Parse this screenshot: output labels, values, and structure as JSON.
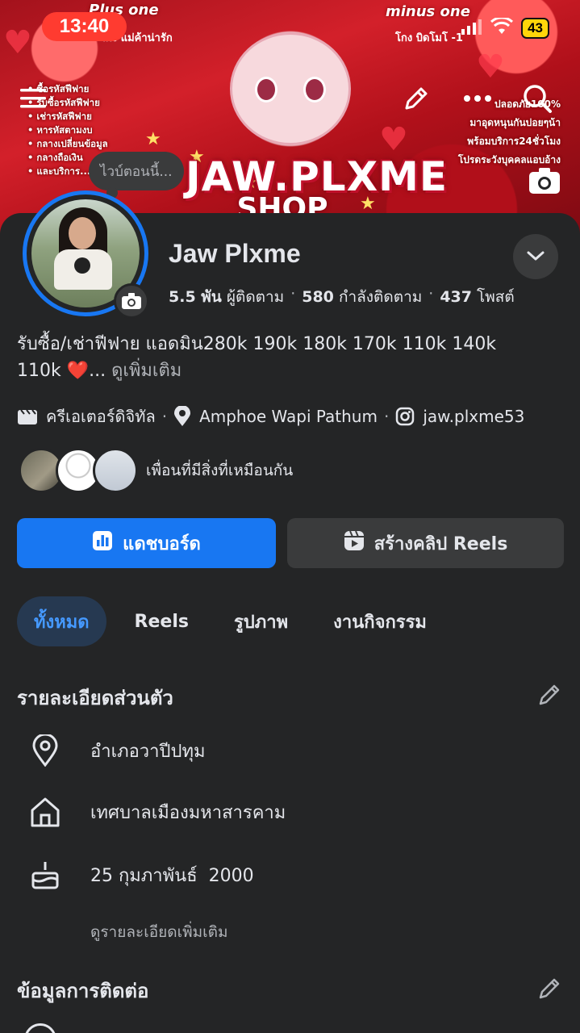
{
  "status_bar": {
    "time": "13:40",
    "battery": "43"
  },
  "cover": {
    "chip_left": "Plus one",
    "chip_left_sub": "โกง แม่ค้าน่ารัก",
    "chip_right": "minus one",
    "chip_right_sub": "โกง บิดโมโ -1",
    "brand": "JAW.PLXME",
    "brand_sub": "SHOP",
    "left_list": [
      "ซื้อรหัสฟีฟาย",
      "รับซื้อรหัสฟีฟาย",
      "เช่ารหัสฟีฟาย",
      "หารหัสตามงบ",
      "กลางเปลี่ยนข้อมูล",
      "กลางถือเงิน",
      "และบริการ..."
    ],
    "right_list": [
      "ปลอดภัย100%",
      "มาอุดหนุนกันบ่อยๆน้า",
      "พร้อมบริการ24ชั่วโมง",
      "โปรดระวังบุคคลแอบอ้าง"
    ]
  },
  "note_bubble": "ไวบ์ตอนนี้...",
  "profile": {
    "name": "Jaw Plxme",
    "followers_count": "5.5 พัน",
    "followers_label": "ผู้ติดตาม",
    "following_count": "580",
    "following_label": "กำลังติดตาม",
    "posts_count": "437",
    "posts_label": "โพสต์",
    "bio_line1": "รับซื้อ/เช่าฟีฟาย แอดมิน280k 190k 180k 170k 110k 140k",
    "bio_line2_prefix": "110k",
    "bio_heart": "❤️",
    "bio_ellipsis": "...",
    "bio_more": "ดูเพิ่มเติม",
    "category": "ครีเอเตอร์ดิจิทัล",
    "location": "Amphoe Wapi Pathum",
    "instagram": "jaw.plxme53",
    "mutual_label": "เพื่อนที่มีสิ่งที่เหมือนกัน"
  },
  "buttons": {
    "dashboard": "แดชบอร์ด",
    "create_reels": "สร้างคลิป Reels"
  },
  "tabs": [
    {
      "label": "ทั้งหมด",
      "active": true
    },
    {
      "label": "Reels",
      "active": false
    },
    {
      "label": "รูปภาพ",
      "active": false
    },
    {
      "label": "งานกิจกรรม",
      "active": false
    }
  ],
  "personal_details": {
    "title": "รายละเอียดส่วนตัว",
    "items": [
      {
        "icon": "location-pin-icon",
        "text": "อำเภอวาปีปทุม"
      },
      {
        "icon": "home-icon",
        "text": "เทศบาลเมืองมหาสารคาม"
      },
      {
        "icon": "birthday-cake-icon",
        "text": "25 กุมภาพันธ์  2000"
      }
    ],
    "see_more": "ดูรายละเอียดเพิ่มเติม"
  },
  "contact_info": {
    "title": "ข้อมูลการติดต่อ"
  },
  "colors": {
    "accent": "#1877f2",
    "background": "#242526",
    "surface": "#3a3b3c",
    "tab_active_bg": "#263951",
    "status_time_bg": "#ff3b30",
    "battery": "#ffd60a"
  }
}
